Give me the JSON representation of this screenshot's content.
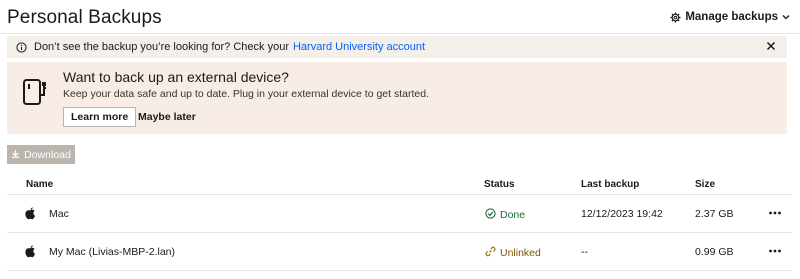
{
  "header": {
    "title": "Personal Backups",
    "manage_label": "Manage backups"
  },
  "notice": {
    "text": "Don’t see the backup you’re looking for? Check your",
    "link": "Harvard University account"
  },
  "promo": {
    "title": "Want to back up an external device?",
    "description": "Keep your data safe and up to date. Plug in your external device to get started.",
    "learn_more": "Learn more",
    "maybe_later": "Maybe later"
  },
  "toolbar": {
    "download_label": "Download"
  },
  "table": {
    "columns": [
      "Name",
      "Status",
      "Last backup",
      "Size"
    ],
    "rows": [
      {
        "name": "Mac",
        "status": "Done",
        "last_backup": "12/12/2023 19:42",
        "size": "2.37 GB"
      },
      {
        "name": "My Mac (Livias-MBP-2.lan)",
        "status": "Unlinked",
        "last_backup": "--",
        "size": "0.99 GB"
      }
    ]
  },
  "colors": {
    "accent_link": "#0061fe",
    "banner_bg": "#f5efe9",
    "done_green": "#1e6b3a",
    "unlinked_amber": "#a0700a",
    "disabled_button": "#bbb5ae"
  },
  "icons": {
    "manage": "gear-icon",
    "notice": "info-icon",
    "close": "close-icon",
    "promo": "external-drive-icon",
    "download": "download-icon",
    "device": "apple-icon",
    "done": "check-circle-icon",
    "unlinked": "link-icon",
    "more": "more-horizontal-icon"
  }
}
